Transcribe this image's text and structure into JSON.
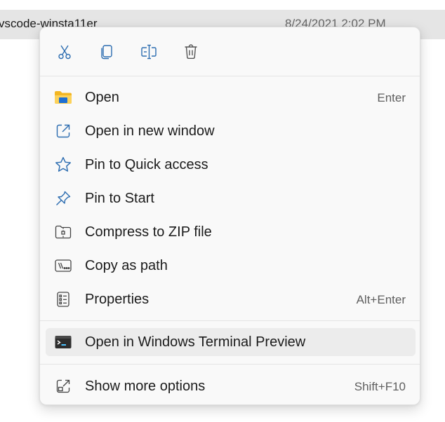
{
  "background": {
    "file_name": "vscode-winsta11er",
    "file_date": "8/24/2021 2:02 PM"
  },
  "toolbar": {
    "cut_icon": "scissors-icon",
    "copy_icon": "copy-icon",
    "rename_icon": "rename-icon",
    "delete_icon": "trash-icon"
  },
  "menu": {
    "items": [
      {
        "label": "Open",
        "shortcut": "Enter",
        "icon": "folder-icon"
      },
      {
        "label": "Open in new window",
        "shortcut": "",
        "icon": "open-new-window-icon"
      },
      {
        "label": "Pin to Quick access",
        "shortcut": "",
        "icon": "star-icon"
      },
      {
        "label": "Pin to Start",
        "shortcut": "",
        "icon": "pin-icon"
      },
      {
        "label": "Compress to ZIP file",
        "shortcut": "",
        "icon": "zip-icon"
      },
      {
        "label": "Copy as path",
        "shortcut": "",
        "icon": "path-icon"
      },
      {
        "label": "Properties",
        "shortcut": "Alt+Enter",
        "icon": "properties-icon"
      },
      {
        "label": "Open in Windows Terminal Preview",
        "shortcut": "",
        "icon": "terminal-icon"
      },
      {
        "label": "Show more options",
        "shortcut": "Shift+F10",
        "icon": "show-more-icon"
      }
    ]
  },
  "colors": {
    "accent": "#0067c0",
    "menu_background": "#f9f9f9",
    "hover_background": "#ececec",
    "folder_yellow": "#f8c33b"
  }
}
